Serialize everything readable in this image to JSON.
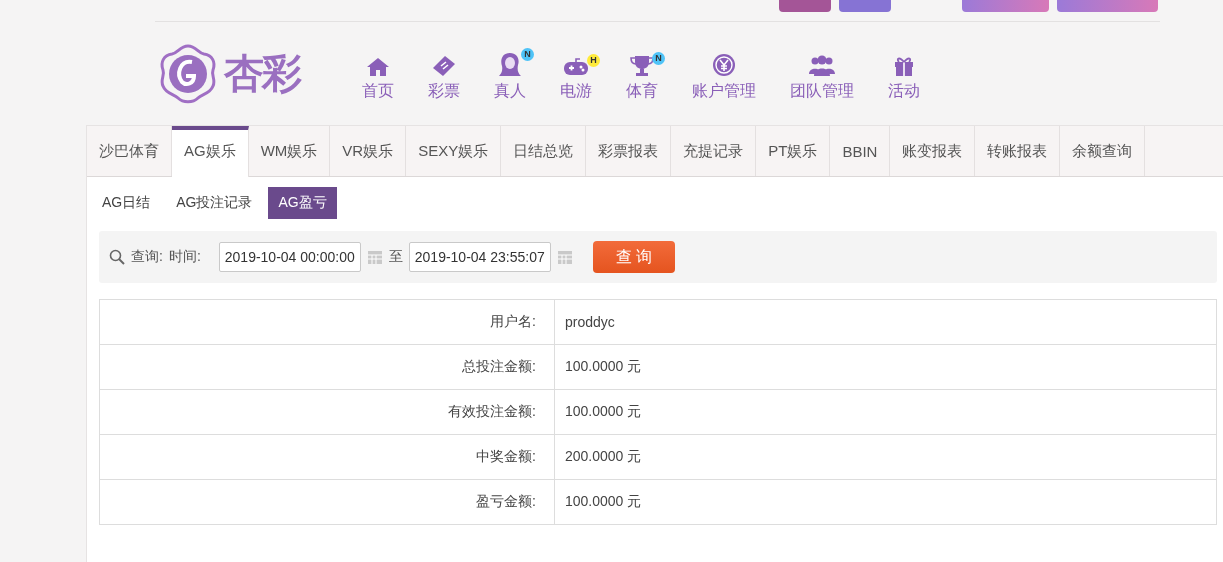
{
  "logo": {
    "text": "杏彩"
  },
  "nav": [
    {
      "label": "首页",
      "kind": "home"
    },
    {
      "label": "彩票",
      "kind": "ticket"
    },
    {
      "label": "真人",
      "kind": "person",
      "badge": "N",
      "color": "#4fc3f7"
    },
    {
      "label": "电游",
      "kind": "gamepad",
      "badge": "H",
      "color": "#ffeb3b"
    },
    {
      "label": "体育",
      "kind": "trophy",
      "badge": "N",
      "color": "#4fc3f7"
    },
    {
      "label": "账户管理",
      "kind": "coin"
    },
    {
      "label": "团队管理",
      "kind": "team"
    },
    {
      "label": "活动",
      "kind": "gift"
    }
  ],
  "tabs": [
    {
      "label": "沙巴体育",
      "selected": false
    },
    {
      "label": "AG娱乐",
      "selected": true
    },
    {
      "label": "WM娱乐",
      "selected": false
    },
    {
      "label": "VR娱乐",
      "selected": false
    },
    {
      "label": "SEXY娱乐",
      "selected": false
    },
    {
      "label": "日结总览",
      "selected": false
    },
    {
      "label": "彩票报表",
      "selected": false
    },
    {
      "label": "充提记录",
      "selected": false
    },
    {
      "label": "PT娱乐",
      "selected": false
    },
    {
      "label": "BBIN",
      "selected": false
    },
    {
      "label": "账变报表",
      "selected": false
    },
    {
      "label": "转账报表",
      "selected": false
    },
    {
      "label": "余额查询",
      "selected": false
    }
  ],
  "subtabs": [
    {
      "label": "AG日结",
      "selected": false
    },
    {
      "label": "AG投注记录",
      "selected": false
    },
    {
      "label": "AG盈亏",
      "selected": true
    }
  ],
  "query": {
    "label": "查询:",
    "time_label": "时间:",
    "start": "2019-10-04 00:00:00",
    "separator": "至",
    "end": "2019-10-04 23:55:07",
    "button": "查 询"
  },
  "results": [
    {
      "label": "用户名:",
      "value": "proddyc"
    },
    {
      "label": "总投注金额:",
      "value": "100.0000 元"
    },
    {
      "label": "有效投注金额:",
      "value": "100.0000 元"
    },
    {
      "label": "中奖金额:",
      "value": "200.0000 元"
    },
    {
      "label": "盈亏金额:",
      "value": "100.0000 元"
    }
  ]
}
